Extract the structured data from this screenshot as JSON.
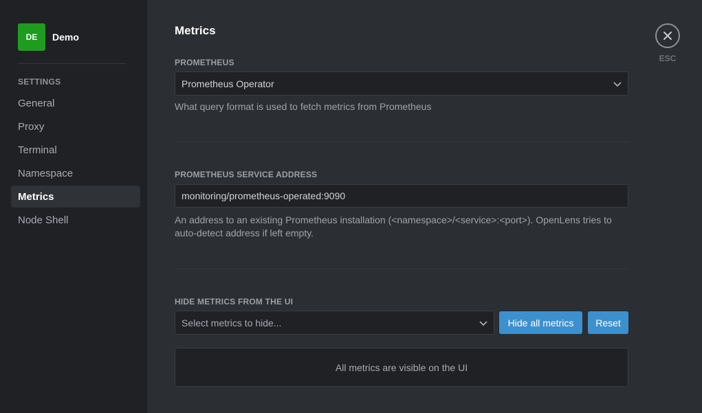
{
  "cluster": {
    "initials": "DE",
    "name": "Demo",
    "color": "#1f9b1f"
  },
  "sidebar": {
    "section": "SETTINGS",
    "items": [
      {
        "label": "General",
        "active": false
      },
      {
        "label": "Proxy",
        "active": false
      },
      {
        "label": "Terminal",
        "active": false
      },
      {
        "label": "Namespace",
        "active": false
      },
      {
        "label": "Metrics",
        "active": true
      },
      {
        "label": "Node Shell",
        "active": false
      }
    ]
  },
  "page": {
    "title": "Metrics"
  },
  "prometheus": {
    "label": "PROMETHEUS",
    "selected": "Prometheus Operator",
    "hint": "What query format is used to fetch metrics from Prometheus"
  },
  "service_address": {
    "label": "PROMETHEUS SERVICE ADDRESS",
    "value": "monitoring/prometheus-operated:9090",
    "hint_line1": "An address to an existing Prometheus installation (<namespace>/<service>:<port>). OpenLens tries to",
    "hint_line2": "auto-detect address if left empty."
  },
  "hide_metrics": {
    "label": "HIDE METRICS FROM THE UI",
    "placeholder": "Select metrics to hide...",
    "hide_all_label": "Hide all metrics",
    "reset_label": "Reset",
    "empty_message": "All metrics are visible on the UI"
  },
  "close": {
    "label": "ESC",
    "icon": "close-icon"
  },
  "colors": {
    "accent": "#3d90ce",
    "sidebar_bg": "#1f2125",
    "main_bg": "#2b2e33"
  }
}
